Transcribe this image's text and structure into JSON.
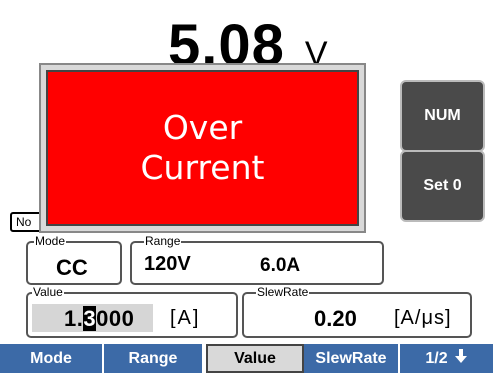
{
  "reading": {
    "value": "5.08",
    "unit": "V"
  },
  "status_label": "No",
  "alert": {
    "line1": "Over",
    "line2": "Current",
    "color": "#ff0000"
  },
  "side_buttons": {
    "num": "NUM",
    "set0": "Set 0"
  },
  "mode": {
    "legend": "Mode",
    "value": "CC"
  },
  "range": {
    "legend": "Range",
    "voltage": "120V",
    "current": "6.0A"
  },
  "value": {
    "legend": "Value",
    "before_cursor": "1.",
    "cursor_digit": "3",
    "after_cursor": "000",
    "unit": "[A]"
  },
  "slewrate": {
    "legend": "SlewRate",
    "value": "0.20",
    "unit": "[A/μs]"
  },
  "softkeys": {
    "mode": "Mode",
    "range": "Range",
    "value": "Value",
    "slewrate": "SlewRate",
    "page": "1/2"
  },
  "colors": {
    "softkey": "#3c6aa7",
    "alert": "#ff0000",
    "side_button": "#4a4a4a"
  }
}
